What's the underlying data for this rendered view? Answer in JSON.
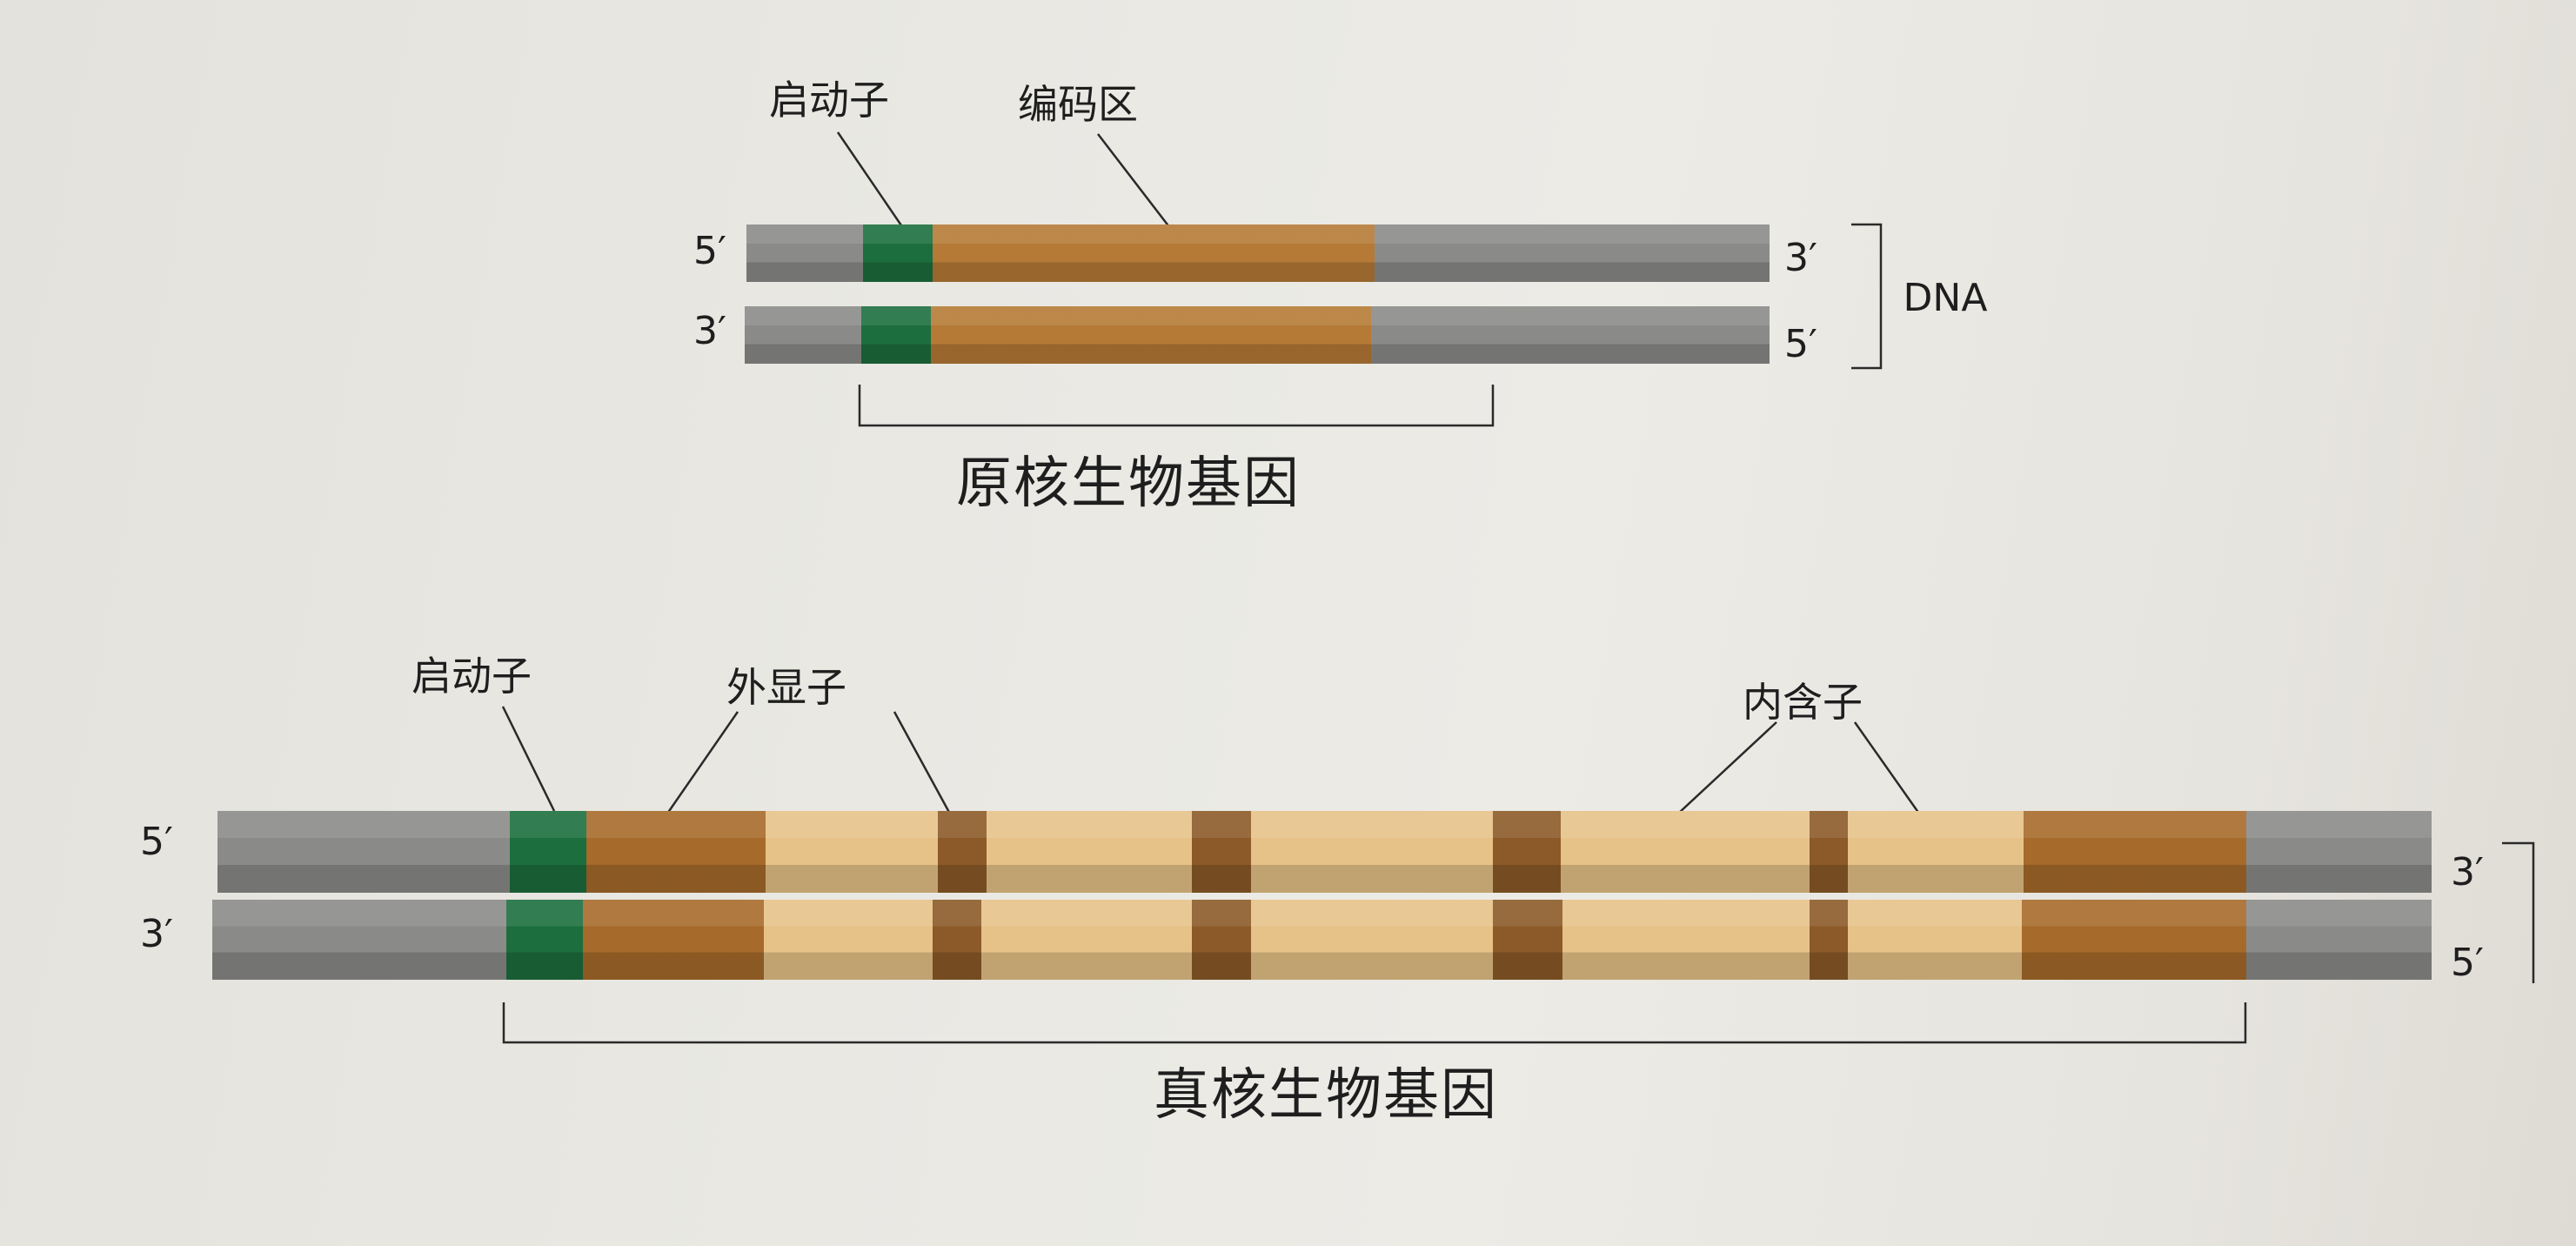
{
  "prokaryote": {
    "promoter_label": "启动子",
    "coding_region_label": "编码区",
    "top_strand": {
      "left_end": "5′",
      "right_end": "3′"
    },
    "bottom_strand": {
      "left_end": "3′",
      "right_end": "5′"
    },
    "dna_label": "DNA",
    "caption": "原核生物基因"
  },
  "eukaryote": {
    "promoter_label": "启动子",
    "exon_label": "外显子",
    "intron_label": "内含子",
    "top_strand": {
      "left_end": "5′",
      "right_end": "3′"
    },
    "bottom_strand": {
      "left_end": "3′",
      "right_end": "5′"
    },
    "caption": "真核生物基因"
  },
  "colors": {
    "flank": "#8a8b88",
    "promoter": "#1c6e3e",
    "coding": "#b57a36",
    "exon": "#a66a2a",
    "intron": "#e6c288",
    "intron_dark_band": "#8b5a28",
    "line": "#2a2a2a"
  }
}
